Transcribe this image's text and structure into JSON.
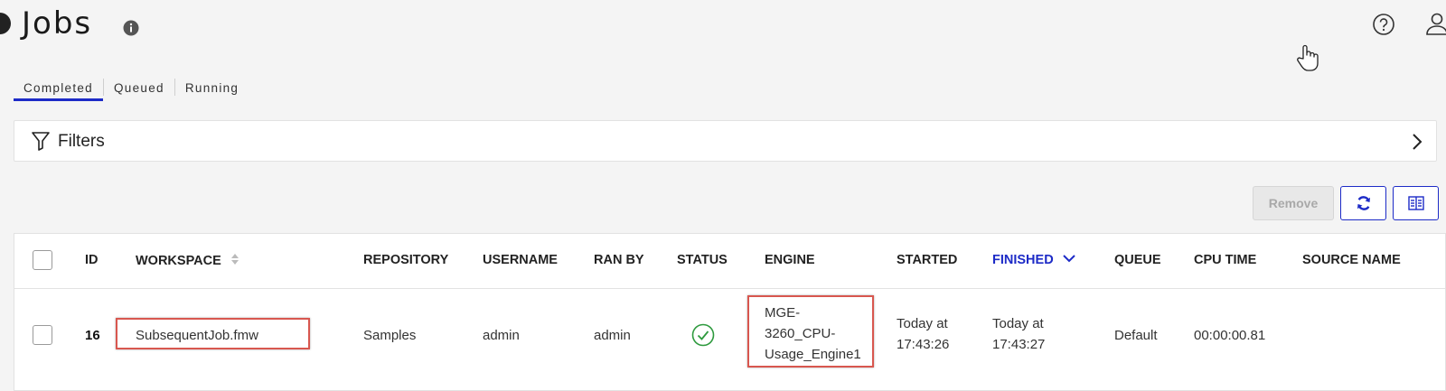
{
  "header": {
    "title": "Jobs",
    "icons": {
      "info": "info-icon",
      "help": "help-icon",
      "user": "user-icon"
    }
  },
  "tabs": [
    {
      "label": "Completed",
      "active": true
    },
    {
      "label": "Queued",
      "active": false
    },
    {
      "label": "Running",
      "active": false
    }
  ],
  "filters": {
    "label": "Filters"
  },
  "toolbar": {
    "remove_label": "Remove",
    "refresh_icon": "refresh-icon",
    "columns_icon": "columns-icon"
  },
  "table": {
    "columns": [
      "ID",
      "WORKSPACE",
      "REPOSITORY",
      "USERNAME",
      "RAN BY",
      "STATUS",
      "ENGINE",
      "STARTED",
      "FINISHED",
      "QUEUE",
      "CPU TIME",
      "SOURCE NAME"
    ],
    "sorted_column": "FINISHED",
    "rows": [
      {
        "id": "16",
        "workspace": "SubsequentJob.fmw",
        "repository": "Samples",
        "username": "admin",
        "ran_by": "admin",
        "status": "success",
        "engine": [
          "MGE-",
          "3260_CPU-",
          "Usage_Engine1"
        ],
        "started": [
          "Today at",
          "17:43:26"
        ],
        "finished": [
          "Today at",
          "17:43:27"
        ],
        "queue": "Default",
        "cpu_time": "00:00:00.81",
        "source_name": ""
      }
    ]
  },
  "colors": {
    "accent": "#1d2bc7",
    "success": "#2e9a3e",
    "highlight": "#d8574f"
  }
}
